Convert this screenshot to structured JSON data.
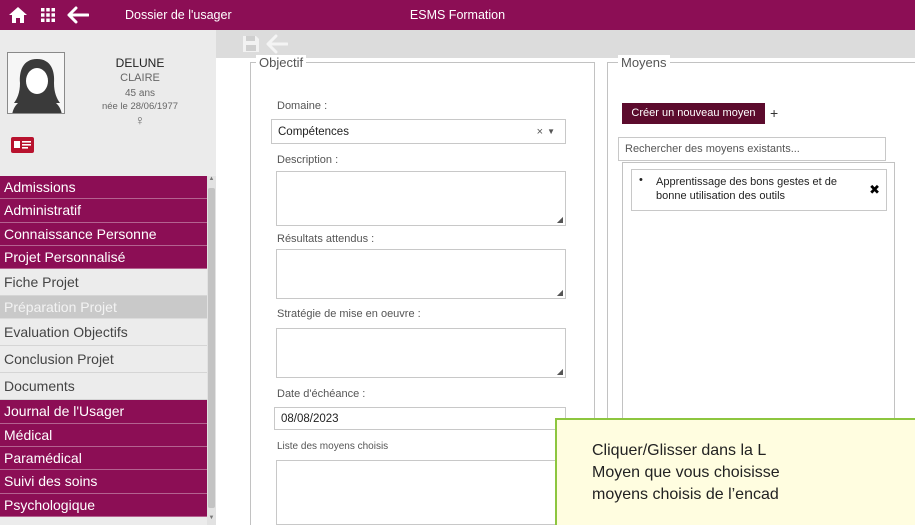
{
  "topbar": {
    "breadcrumb": "Dossier de l'usager",
    "app_title": "ESMS Formation"
  },
  "patient": {
    "last_name": "DELUNE",
    "first_name": "CLAIRE",
    "age": "45 ans",
    "birth": "née le 28/06/1977",
    "sex_symbol": "♀"
  },
  "menu": [
    {
      "label": "Admissions",
      "style": "prim"
    },
    {
      "label": "Administratif",
      "style": "prim"
    },
    {
      "label": "Connaissance Personne",
      "style": "prim"
    },
    {
      "label": "Projet Personnalisé",
      "style": "prim"
    },
    {
      "label": "Fiche Projet",
      "style": "sub"
    },
    {
      "label": "Préparation Projet",
      "style": "disabled"
    },
    {
      "label": "Evaluation Objectifs",
      "style": "sub"
    },
    {
      "label": "Conclusion Projet",
      "style": "sub"
    },
    {
      "label": "Documents",
      "style": "sub"
    },
    {
      "label": "Journal de l'Usager",
      "style": "prim"
    },
    {
      "label": "Médical",
      "style": "prim"
    },
    {
      "label": "Paramédical",
      "style": "prim"
    },
    {
      "label": "Suivi des soins",
      "style": "prim"
    },
    {
      "label": "Psychologique",
      "style": "prim"
    }
  ],
  "objectif": {
    "legend": "Objectif",
    "domaine_label": "Domaine :",
    "domaine_value": "Compétences",
    "clear_symbol": "×",
    "caret_symbol": "▼",
    "description_label": "Description :",
    "resultats_label": "Résultats attendus :",
    "strategie_label": "Stratégie de mise en oeuvre :",
    "date_label": "Date d'échéance :",
    "date_value": "08/08/2023",
    "liste_label": "Liste des moyens choisis"
  },
  "moyens": {
    "legend": "Moyens",
    "create_label": "Créer un nouveau moyen",
    "plus_label": "+",
    "search_placeholder": "Rechercher des moyens existants...",
    "items": [
      {
        "line1": "Apprentissage des bons gestes et de",
        "line2": "bonne utilisation des outils",
        "bullet": "•",
        "delete": "✖"
      }
    ]
  },
  "tooltip": {
    "line1": "Cliquer/Glisser dans la L",
    "line2": "Moyen que vous choisisse",
    "line3": "moyens choisis de l’encad"
  },
  "colors": {
    "primary": "#8c0e55",
    "button_dark": "#5c0b2d",
    "tooltip_border": "#8dc63f",
    "tooltip_bg": "#fffde0"
  },
  "icons": [
    "home-icon",
    "grid-icon",
    "back-arrow-icon",
    "save-icon",
    "id-card-icon",
    "avatar-icon",
    "close-icon"
  ]
}
